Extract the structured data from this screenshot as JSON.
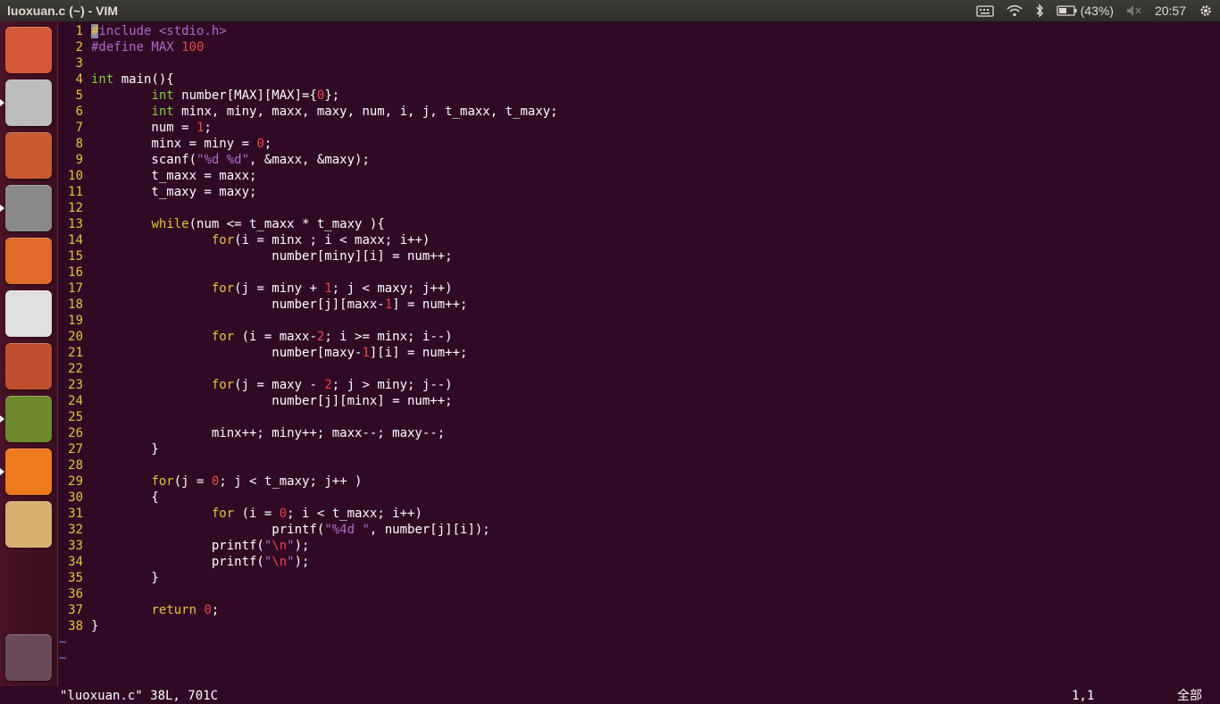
{
  "window": {
    "title": "luoxuan.c (~) - VIM"
  },
  "indicators": {
    "battery": "(43%)",
    "clock": "20:57"
  },
  "launcher": [
    {
      "name": "ubuntu-dash-icon",
      "bg": "#d65a37",
      "running": false
    },
    {
      "name": "terminal-icon",
      "bg": "#bdbdbd",
      "running": true
    },
    {
      "name": "firefox-icon",
      "bg": "#c85a2e",
      "running": false
    },
    {
      "name": "files-icon",
      "bg": "#8a8a8a",
      "running": true
    },
    {
      "name": "software-center-icon",
      "bg": "#e06a2a",
      "running": false
    },
    {
      "name": "amazon-icon",
      "bg": "#e0e0e0",
      "running": false
    },
    {
      "name": "system-settings-icon",
      "bg": "#c05030",
      "running": false
    },
    {
      "name": "ebook-reader-icon",
      "bg": "#6f8a2a",
      "running": true
    },
    {
      "name": "pdf-reader-icon",
      "bg": "#ee7a1e",
      "running": true
    },
    {
      "name": "image-viewer-icon",
      "bg": "#d8b070",
      "running": false
    },
    {
      "name": "trash-icon",
      "bg": "#6a4a58",
      "running": false
    }
  ],
  "code_lines": [
    [
      [
        "k",
        "#"
      ],
      [
        "p",
        "include "
      ],
      [
        "s",
        "<stdio.h>"
      ]
    ],
    [
      [
        "p",
        "#define MAX "
      ],
      [
        "n",
        "100"
      ]
    ],
    [],
    [
      [
        "t",
        "int"
      ],
      [
        "d",
        " main(){"
      ]
    ],
    [
      [
        "d",
        "        "
      ],
      [
        "t",
        "int"
      ],
      [
        "d",
        " number[MAX][MAX]={"
      ],
      [
        "n",
        "0"
      ],
      [
        "d",
        "};"
      ]
    ],
    [
      [
        "d",
        "        "
      ],
      [
        "t",
        "int"
      ],
      [
        "d",
        " minx, miny, maxx, maxy, num, i, j, t_maxx, t_maxy;"
      ]
    ],
    [
      [
        "d",
        "        num = "
      ],
      [
        "n",
        "1"
      ],
      [
        "d",
        ";"
      ]
    ],
    [
      [
        "d",
        "        minx = miny = "
      ],
      [
        "n",
        "0"
      ],
      [
        "d",
        ";"
      ]
    ],
    [
      [
        "d",
        "        scanf("
      ],
      [
        "s",
        "\"%d %d\""
      ],
      [
        "d",
        ", &maxx, &maxy);"
      ]
    ],
    [
      [
        "d",
        "        t_maxx = maxx;"
      ]
    ],
    [
      [
        "d",
        "        t_maxy = maxy;"
      ]
    ],
    [],
    [
      [
        "d",
        "        "
      ],
      [
        "k",
        "while"
      ],
      [
        "d",
        "(num <= t_maxx * t_maxy ){"
      ]
    ],
    [
      [
        "d",
        "                "
      ],
      [
        "k",
        "for"
      ],
      [
        "d",
        "(i = minx ; i < maxx; i++)"
      ]
    ],
    [
      [
        "d",
        "                        number[miny][i] = num++;"
      ]
    ],
    [],
    [
      [
        "d",
        "                "
      ],
      [
        "k",
        "for"
      ],
      [
        "d",
        "(j = miny + "
      ],
      [
        "n",
        "1"
      ],
      [
        "d",
        "; j < maxy; j++)"
      ]
    ],
    [
      [
        "d",
        "                        number[j][maxx-"
      ],
      [
        "n",
        "1"
      ],
      [
        "d",
        "] = num++;"
      ]
    ],
    [],
    [
      [
        "d",
        "                "
      ],
      [
        "k",
        "for"
      ],
      [
        "d",
        " (i = maxx-"
      ],
      [
        "n",
        "2"
      ],
      [
        "d",
        "; i >= minx; i--)"
      ]
    ],
    [
      [
        "d",
        "                        number[maxy-"
      ],
      [
        "n",
        "1"
      ],
      [
        "d",
        "][i] = num++;"
      ]
    ],
    [],
    [
      [
        "d",
        "                "
      ],
      [
        "k",
        "for"
      ],
      [
        "d",
        "(j = maxy - "
      ],
      [
        "n",
        "2"
      ],
      [
        "d",
        "; j > miny; j--)"
      ]
    ],
    [
      [
        "d",
        "                        number[j][minx] = num++;"
      ]
    ],
    [],
    [
      [
        "d",
        "                minx++; miny++; maxx--; maxy--;"
      ]
    ],
    [
      [
        "d",
        "        }"
      ]
    ],
    [],
    [
      [
        "d",
        "        "
      ],
      [
        "k",
        "for"
      ],
      [
        "d",
        "(j = "
      ],
      [
        "n",
        "0"
      ],
      [
        "d",
        "; j < t_maxy; j++ )"
      ]
    ],
    [
      [
        "d",
        "        {"
      ]
    ],
    [
      [
        "d",
        "                "
      ],
      [
        "k",
        "for"
      ],
      [
        "d",
        " (i = "
      ],
      [
        "n",
        "0"
      ],
      [
        "d",
        "; i < t_maxx; i++)"
      ]
    ],
    [
      [
        "d",
        "                        printf("
      ],
      [
        "s",
        "\"%4d \""
      ],
      [
        "d",
        ", number[j][i]);"
      ]
    ],
    [
      [
        "d",
        "                printf("
      ],
      [
        "s",
        "\""
      ],
      [
        "n",
        "\\n"
      ],
      [
        "s",
        "\""
      ],
      [
        "d",
        ");"
      ]
    ],
    [
      [
        "d",
        "                printf("
      ],
      [
        "s",
        "\""
      ],
      [
        "n",
        "\\n"
      ],
      [
        "s",
        "\""
      ],
      [
        "d",
        ");"
      ]
    ],
    [
      [
        "d",
        "        }"
      ]
    ],
    [],
    [
      [
        "d",
        "        "
      ],
      [
        "k",
        "return"
      ],
      [
        "d",
        " "
      ],
      [
        "n",
        "0"
      ],
      [
        "d",
        ";"
      ]
    ],
    [
      [
        "d",
        "}"
      ]
    ]
  ],
  "tildes": [
    "~",
    "~"
  ],
  "statusline": {
    "file_info": "\"luoxuan.c\" 38L, 701C",
    "position": "1,1",
    "scroll": "全部"
  },
  "colors": {
    "background": "#300a24",
    "line_number": "#e8c23a",
    "keyword": "#e8c23a",
    "type": "#7fd13b",
    "preproc": "#b06ac8",
    "string": "#b06ac8",
    "number": "#e84646",
    "default": "#ffffff",
    "tilde": "#6d7fd6"
  }
}
